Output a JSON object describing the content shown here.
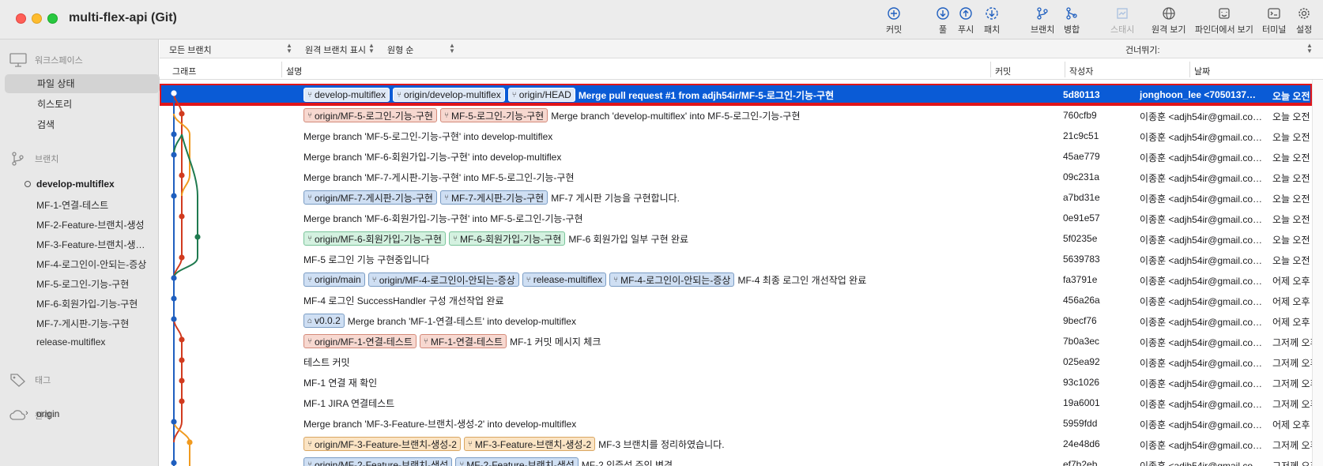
{
  "window": {
    "title": "multi-flex-api (Git)"
  },
  "toolbar": [
    {
      "id": "commit",
      "label": "커밋",
      "icon": "plus-circle-icon"
    },
    {
      "id": "pull",
      "label": "풀",
      "icon": "download-arrow-icon"
    },
    {
      "id": "push",
      "label": "푸시",
      "icon": "upload-arrow-icon"
    },
    {
      "id": "fetch",
      "label": "패치",
      "icon": "fetch-icon"
    },
    {
      "id": "branch",
      "label": "브랜치",
      "icon": "branch-icon"
    },
    {
      "id": "merge",
      "label": "병합",
      "icon": "merge-icon"
    },
    {
      "id": "stash",
      "label": "스태시",
      "icon": "stash-icon"
    },
    {
      "id": "remote",
      "label": "원격 보기",
      "icon": "globe-icon"
    },
    {
      "id": "finder",
      "label": "파인더에서 보기",
      "icon": "finder-icon"
    },
    {
      "id": "terminal",
      "label": "터미널",
      "icon": "terminal-icon"
    },
    {
      "id": "settings",
      "label": "설정",
      "icon": "gear-icon"
    }
  ],
  "sidebar": {
    "workspace": {
      "label": "워크스페이스",
      "items": [
        "파일 상태",
        "히스토리",
        "검색"
      ]
    },
    "branches": {
      "label": "브랜치",
      "items": [
        "develop-multiflex",
        "MF-1-연결-테스트",
        "MF-2-Feature-브랜치-생성",
        "MF-3-Feature-브랜치-생…",
        "MF-4-로그인이-안되는-증상",
        "MF-5-로그인-기능-구현",
        "MF-6-회원가입-기능-구현",
        "MF-7-게시판-기능-구현",
        "release-multiflex"
      ]
    },
    "tags": {
      "label": "태그"
    },
    "remotes": {
      "label": "원격",
      "items": [
        "origin"
      ]
    }
  },
  "filterbar": {
    "branches": "모든 브랜치",
    "show_remote": "원격 브랜치 표시",
    "order": "원형 순",
    "jump": "건너뛰기:"
  },
  "columns": {
    "graph": "그래프",
    "description": "설명",
    "commit": "커밋",
    "author": "작성자",
    "date": "날짜"
  },
  "colors": {
    "selection": "#0a5bd6",
    "highlight_border": "#e0151a",
    "lane_blue": "#1f5fbf",
    "lane_red": "#d13b1f",
    "lane_orange": "#f09a1f",
    "lane_green": "#1f7a4f"
  },
  "commits": [
    {
      "tags": [
        {
          "t": "develop-multiflex",
          "c": "blue",
          "i": "branch"
        },
        {
          "t": "origin/develop-multiflex",
          "c": "blue",
          "i": "branch"
        },
        {
          "t": "origin/HEAD",
          "c": "blue",
          "i": "branch"
        }
      ],
      "message": "Merge pull request #1 from adjh54ir/MF-5-로그인-기능-구현",
      "hash": "5d80113",
      "author": "jonghoon_lee <7050137…",
      "date": "오늘 오전"
    },
    {
      "tags": [
        {
          "t": "origin/MF-5-로그인-기능-구현",
          "c": "red",
          "i": "branch"
        },
        {
          "t": "MF-5-로그인-기능-구현",
          "c": "red",
          "i": "branch"
        }
      ],
      "message": "Merge branch 'develop-multiflex' into MF-5-로그인-기능-구현",
      "hash": "760cfb9",
      "author": "이종훈 <adjh54ir@gmail.co…",
      "date": "오늘 오전"
    },
    {
      "tags": [],
      "message": "Merge branch 'MF-5-로그인-기능-구현' into develop-multiflex",
      "hash": "21c9c51",
      "author": "이종훈 <adjh54ir@gmail.co…",
      "date": "오늘 오전"
    },
    {
      "tags": [],
      "message": "Merge branch 'MF-6-회원가입-기능-구현' into develop-multiflex",
      "hash": "45ae779",
      "author": "이종훈 <adjh54ir@gmail.co…",
      "date": "오늘 오전"
    },
    {
      "tags": [],
      "message": "Merge branch 'MF-7-게시판-기능-구현' into MF-5-로그인-기능-구현",
      "hash": "09c231a",
      "author": "이종훈 <adjh54ir@gmail.co…",
      "date": "오늘 오전"
    },
    {
      "tags": [
        {
          "t": "origin/MF-7-게시판-기능-구현",
          "c": "blue",
          "i": "branch"
        },
        {
          "t": "MF-7-게시판-기능-구현",
          "c": "blue",
          "i": "branch"
        }
      ],
      "message": "MF-7 게시판 기능을 구현합니다.",
      "hash": "a7bd31e",
      "author": "이종훈 <adjh54ir@gmail.co…",
      "date": "오늘 오전"
    },
    {
      "tags": [],
      "message": "Merge branch 'MF-6-회원가입-기능-구현' into MF-5-로그인-기능-구현",
      "hash": "0e91e57",
      "author": "이종훈 <adjh54ir@gmail.co…",
      "date": "오늘 오전"
    },
    {
      "tags": [
        {
          "t": "origin/MF-6-회원가입-기능-구현",
          "c": "green",
          "i": "branch"
        },
        {
          "t": "MF-6-회원가입-기능-구현",
          "c": "green",
          "i": "branch"
        }
      ],
      "message": "MF-6 회원가입 일부 구현 완료",
      "hash": "5f0235e",
      "author": "이종훈 <adjh54ir@gmail.co…",
      "date": "오늘 오전"
    },
    {
      "tags": [],
      "message": "MF-5 로그인 기능 구현중입니다",
      "hash": "5639783",
      "author": "이종훈 <adjh54ir@gmail.co…",
      "date": "오늘 오전"
    },
    {
      "tags": [
        {
          "t": "origin/main",
          "c": "blue",
          "i": "branch"
        },
        {
          "t": "origin/MF-4-로그인이-안되는-증상",
          "c": "blue",
          "i": "branch"
        },
        {
          "t": "release-multiflex",
          "c": "blue",
          "i": "branch"
        },
        {
          "t": "MF-4-로그인이-안되는-증상",
          "c": "blue",
          "i": "branch"
        }
      ],
      "message": "MF-4 최종 로그인 개선작업 완료",
      "hash": "fa3791e",
      "author": "이종훈 <adjh54ir@gmail.co…",
      "date": "어제 오후"
    },
    {
      "tags": [],
      "message": "MF-4 로그인 SuccessHandler 구성 개선작업 완료",
      "hash": "456a26a",
      "author": "이종훈 <adjh54ir@gmail.co…",
      "date": "어제 오후"
    },
    {
      "tags": [
        {
          "t": "v0.0.2",
          "c": "blue",
          "i": "tag"
        }
      ],
      "message": "Merge branch 'MF-1-연결-테스트' into develop-multiflex",
      "hash": "9becf76",
      "author": "이종훈 <adjh54ir@gmail.co…",
      "date": "어제 오후"
    },
    {
      "tags": [
        {
          "t": "origin/MF-1-연결-테스트",
          "c": "red",
          "i": "branch"
        },
        {
          "t": "MF-1-연결-테스트",
          "c": "red",
          "i": "branch"
        }
      ],
      "message": "MF-1 커밋 메시지 체크",
      "hash": "7b0a3ec",
      "author": "이종훈 <adjh54ir@gmail.co…",
      "date": "그저께 오후"
    },
    {
      "tags": [],
      "message": "테스트 커밋",
      "hash": "025ea92",
      "author": "이종훈 <adjh54ir@gmail.co…",
      "date": "그저께 오후"
    },
    {
      "tags": [],
      "message": "MF-1 연결 재 확인",
      "hash": "93c1026",
      "author": "이종훈 <adjh54ir@gmail.co…",
      "date": "그저께 오후"
    },
    {
      "tags": [],
      "message": "MF-1 JIRA 연결테스트",
      "hash": "19a6001",
      "author": "이종훈 <adjh54ir@gmail.co…",
      "date": "그저께 오후"
    },
    {
      "tags": [],
      "message": "Merge branch 'MF-3-Feature-브랜치-생성-2' into develop-multiflex",
      "hash": "5959fdd",
      "author": "이종훈 <adjh54ir@gmail.co…",
      "date": "어제 오후"
    },
    {
      "tags": [
        {
          "t": "origin/MF-3-Feature-브랜치-생성-2",
          "c": "orange",
          "i": "branch"
        },
        {
          "t": "MF-3-Feature-브랜치-생성-2",
          "c": "orange",
          "i": "branch"
        }
      ],
      "message": "MF-3 브랜치를 정리하였습니다.",
      "hash": "24e48d6",
      "author": "이종훈 <adjh54ir@gmail.co…",
      "date": "그저께 오후"
    },
    {
      "tags": [
        {
          "t": "origin/MF-2-Feature-브랜치-생성",
          "c": "blue",
          "i": "branch"
        },
        {
          "t": "MF-2-Feature-브랜치-생성",
          "c": "blue",
          "i": "branch"
        }
      ],
      "message": "MF-2 인증성 주인 변경",
      "hash": "ef7b2eb",
      "author": "이종훈 <adjh54ir@gmail.co…",
      "date": "그저께 오후"
    }
  ]
}
